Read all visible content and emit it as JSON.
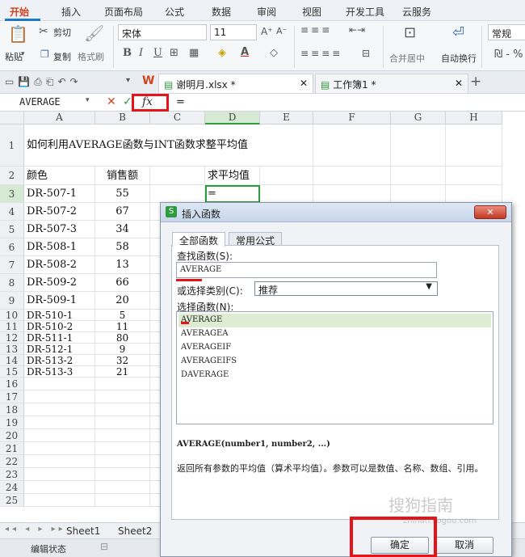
{
  "ribbon_tabs": [
    "开始",
    "插入",
    "页面布局",
    "公式",
    "数据",
    "审阅",
    "视图",
    "开发工具",
    "云服务"
  ],
  "ribbon": {
    "paste": "粘贴",
    "cut": "剪切",
    "copy": "复制",
    "format_painter": "格式刷",
    "font_name": "宋体",
    "font_size": "11",
    "merge": "合并居中",
    "wrap": "自动换行",
    "number_format": "常规"
  },
  "doc_tabs": [
    "谢明月.xlsx *",
    "工作簿1 *"
  ],
  "formula_bar": {
    "name_box": "AVERAGE",
    "fx": "fx",
    "content": "="
  },
  "columns": [
    "A",
    "B",
    "C",
    "D",
    "E",
    "F",
    "G",
    "H"
  ],
  "rows": [
    {
      "num": "1",
      "a": "如何利用AVERAGE函数与INT函数求整平均值",
      "b": "",
      "d": ""
    },
    {
      "num": "2",
      "a": "颜色",
      "b": "销售额",
      "d": "求平均值"
    },
    {
      "num": "3",
      "a": "DR-507-1",
      "b": "55",
      "d": "="
    },
    {
      "num": "4",
      "a": "DR-507-2",
      "b": "67",
      "d": ""
    },
    {
      "num": "5",
      "a": "DR-507-3",
      "b": "34",
      "d": ""
    },
    {
      "num": "6",
      "a": "DR-508-1",
      "b": "58",
      "d": ""
    },
    {
      "num": "7",
      "a": "DR-508-2",
      "b": "13",
      "d": ""
    },
    {
      "num": "8",
      "a": "DR-509-2",
      "b": "66",
      "d": ""
    },
    {
      "num": "9",
      "a": "DR-509-1",
      "b": "20",
      "d": ""
    },
    {
      "num": "10",
      "a": "DR-510-1",
      "b": "5",
      "d": ""
    },
    {
      "num": "11",
      "a": "DR-510-2",
      "b": "11",
      "d": ""
    },
    {
      "num": "12",
      "a": "DR-511-1",
      "b": "80",
      "d": ""
    },
    {
      "num": "13",
      "a": "DR-512-1",
      "b": "9",
      "d": ""
    },
    {
      "num": "14",
      "a": "DR-513-2",
      "b": "32",
      "d": ""
    },
    {
      "num": "15",
      "a": "DR-513-3",
      "b": "21",
      "d": ""
    },
    {
      "num": "16",
      "a": "",
      "b": "",
      "d": ""
    },
    {
      "num": "17",
      "a": "",
      "b": "",
      "d": ""
    },
    {
      "num": "18",
      "a": "",
      "b": "",
      "d": ""
    },
    {
      "num": "19",
      "a": "",
      "b": "",
      "d": ""
    },
    {
      "num": "20",
      "a": "",
      "b": "",
      "d": ""
    },
    {
      "num": "21",
      "a": "",
      "b": "",
      "d": ""
    },
    {
      "num": "22",
      "a": "",
      "b": "",
      "d": ""
    },
    {
      "num": "23",
      "a": "",
      "b": "",
      "d": ""
    },
    {
      "num": "24",
      "a": "",
      "b": "",
      "d": ""
    },
    {
      "num": "25",
      "a": "",
      "b": "",
      "d": ""
    }
  ],
  "sheets": [
    "Sheet1",
    "Sheet2"
  ],
  "status": "编辑状态",
  "dialog": {
    "title": "插入函数",
    "tab_all": "全部函数",
    "tab_common": "常用公式",
    "search_label": "查找函数(S):",
    "search_value": "AVERAGE",
    "category_label": "或选择类别(C):",
    "category_value": "推荐",
    "select_label": "选择函数(N):",
    "functions": [
      "AVERAGE",
      "AVERAGEA",
      "AVERAGEIF",
      "AVERAGEIFS",
      "DAVERAGE"
    ],
    "signature": "AVERAGE(number1, number2, ...)",
    "description": "返回所有参数的平均值（算术平均值）。参数可以是数值、名称、数组、引用。",
    "ok": "确定",
    "cancel": "取消"
  },
  "watermark": "搜狗指南",
  "watermark_url": "zhinan.sogou.com",
  "colors": {
    "accent": "#1c78c8",
    "highlight": "#e3141a",
    "wps_red": "#d0431f",
    "selection_green": "#2e9b3e"
  }
}
